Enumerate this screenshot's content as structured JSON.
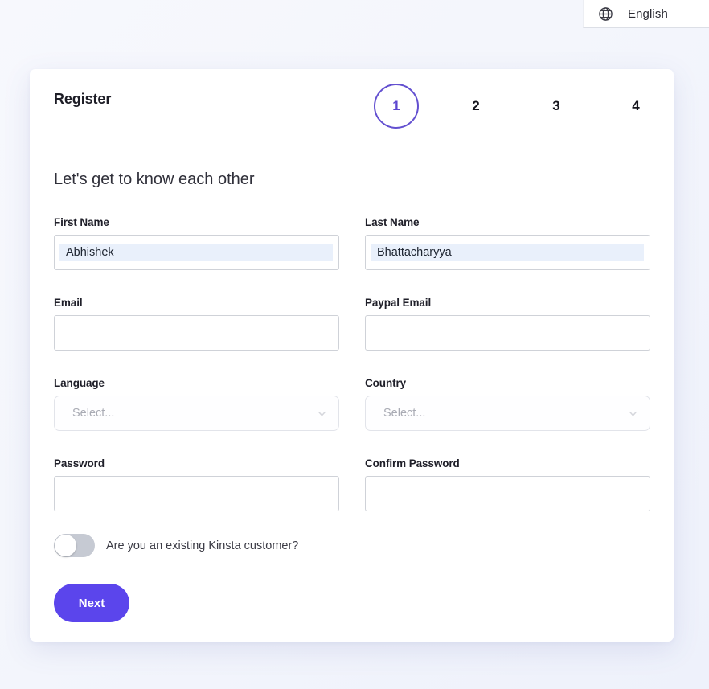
{
  "topbar": {
    "globe_icon": "globe-icon",
    "language": "English"
  },
  "card": {
    "title": "Register",
    "heading": "Let's get to know each other",
    "steps": [
      {
        "label": "1",
        "active": true
      },
      {
        "label": "2",
        "active": false
      },
      {
        "label": "3",
        "active": false
      },
      {
        "label": "4",
        "active": false
      }
    ],
    "fields": {
      "first_name": {
        "label": "First Name",
        "value": "Abhishek",
        "placeholder": ""
      },
      "last_name": {
        "label": "Last Name",
        "value": "Bhattacharyya",
        "placeholder": ""
      },
      "email": {
        "label": "Email",
        "value": "",
        "placeholder": ""
      },
      "paypal_email": {
        "label": "Paypal Email",
        "value": "",
        "placeholder": ""
      },
      "language": {
        "label": "Language",
        "value": "",
        "placeholder": "Select...",
        "chevron_icon": "chevron-down-icon"
      },
      "country": {
        "label": "Country",
        "value": "",
        "placeholder": "Select...",
        "chevron_icon": "chevron-down-icon"
      },
      "password": {
        "label": "Password",
        "value": "",
        "placeholder": ""
      },
      "confirm_password": {
        "label": "Confirm Password",
        "value": "",
        "placeholder": ""
      }
    },
    "toggle": {
      "label": "Are you an existing Kinsta customer?",
      "state": "off"
    },
    "next_button": "Next"
  },
  "colors": {
    "accent": "#5b45ec",
    "step_active": "#5c46cf",
    "autofill_highlight": "#e9f0fb",
    "page_background": "#f4f6fc",
    "card_background": "#ffffff"
  }
}
